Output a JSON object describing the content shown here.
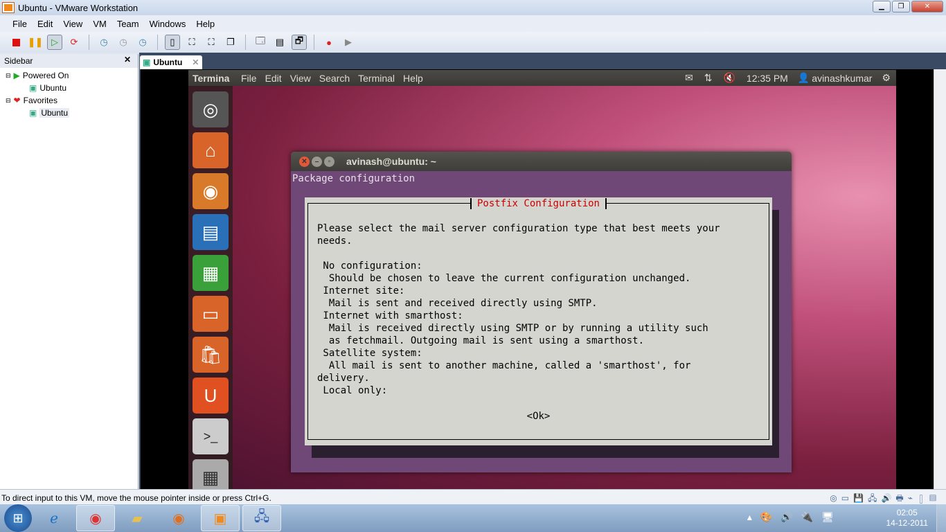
{
  "window": {
    "title": "Ubuntu - VMware Workstation"
  },
  "menu": [
    "File",
    "Edit",
    "View",
    "VM",
    "Team",
    "Windows",
    "Help"
  ],
  "sidebar": {
    "title": "Sidebar",
    "groups": [
      {
        "label": "Powered On",
        "items": [
          "Ubuntu"
        ]
      },
      {
        "label": "Favorites",
        "items": [
          "Ubuntu"
        ]
      }
    ]
  },
  "tab": {
    "label": "Ubuntu"
  },
  "guest": {
    "panel": {
      "app": "Termina",
      "menu": [
        "File",
        "Edit",
        "View",
        "Search",
        "Terminal",
        "Help"
      ],
      "time": "12:35 PM",
      "user": "avinashkumar"
    },
    "terminal": {
      "title": "avinash@ubuntu: ~",
      "header": "Package configuration",
      "dialog": {
        "title": "Postfix Configuration",
        "lines": [
          "Please select the mail server configuration type that best meets your",
          "needs.",
          "",
          " No configuration:",
          "  Should be chosen to leave the current configuration unchanged.",
          " Internet site:",
          "  Mail is sent and received directly using SMTP.",
          " Internet with smarthost:",
          "  Mail is received directly using SMTP or by running a utility such",
          "  as fetchmail. Outgoing mail is sent using a smarthost.",
          " Satellite system:",
          "  All mail is sent to another machine, called a 'smarthost', for",
          "delivery.",
          " Local only:"
        ],
        "ok": "<Ok>"
      }
    }
  },
  "status": {
    "text": "To direct input to this VM, move the mouse pointer inside or press Ctrl+G."
  },
  "taskbar": {
    "time": "02:05",
    "date": "14-12-2011"
  }
}
